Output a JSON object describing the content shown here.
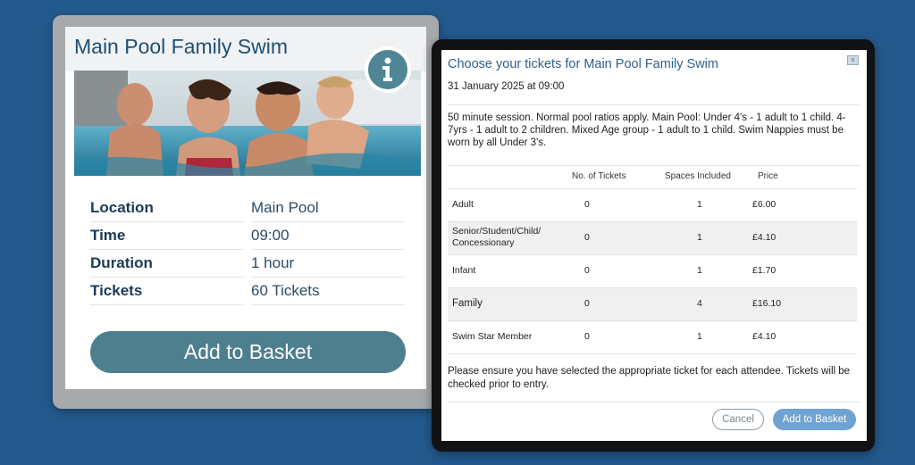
{
  "card": {
    "title": "Main Pool Family Swim",
    "info_icon": "info-icon",
    "details": [
      {
        "label": "Location",
        "value": "Main Pool"
      },
      {
        "label": "Time",
        "value": "09:00"
      },
      {
        "label": "Duration",
        "value": "1 hour"
      },
      {
        "label": "Tickets",
        "value": "60 Tickets"
      }
    ],
    "add_button": "Add to Basket"
  },
  "modal": {
    "title": "Choose your tickets for Main Pool Family Swim",
    "close_label": "x",
    "date": "31 January 2025 at 09:00",
    "description": "50 minute session. Normal pool ratios apply. Main Pool: Under 4's - 1 adult to 1 child. 4-7yrs - 1 adult to 2 children. Mixed Age group - 1 adult to 1 child. Swim Nappies must be worn by all Under 3's.",
    "columns": [
      "No. of Tickets",
      "Spaces Included",
      "Price"
    ],
    "rows": [
      {
        "name": "Adult",
        "qty": "0",
        "spaces": "1",
        "price": "£6.00"
      },
      {
        "name": "Senior/Student/Child/ Concessionary",
        "qty": "0",
        "spaces": "1",
        "price": "£4.10"
      },
      {
        "name": "Infant",
        "qty": "0",
        "spaces": "1",
        "price": "£1.70"
      },
      {
        "name": "Family",
        "qty": "0",
        "spaces": "4",
        "price": "£16.10"
      },
      {
        "name": "Swim Star Member",
        "qty": "0",
        "spaces": "1",
        "price": "£4.10"
      }
    ],
    "note": "Please ensure you have selected the appropriate ticket for each attendee. Tickets will be checked prior to entry.",
    "cancel_label": "Cancel",
    "add_label": "Add to Basket"
  },
  "colors": {
    "background": "#235a8e",
    "card_frame": "#a7a9ac",
    "title_blue": "#1e4f73",
    "add_button": "#4e7f8f",
    "modal_add": "#6fa3d3"
  }
}
